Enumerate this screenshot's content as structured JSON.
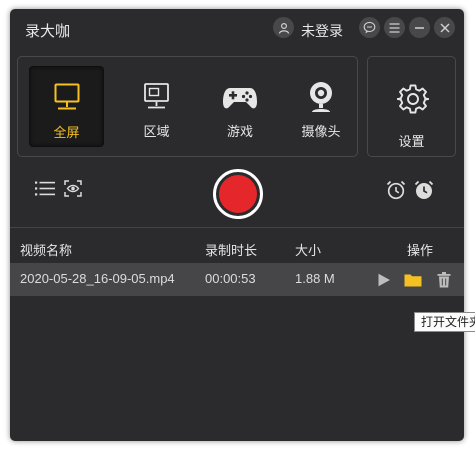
{
  "app": {
    "title": "录大咖"
  },
  "header": {
    "login_status": "未登录",
    "buttons": [
      "chat-icon",
      "menu-icon",
      "minimize-icon",
      "close-icon"
    ]
  },
  "modes": [
    {
      "label": "全屏",
      "icon": "monitor-icon",
      "selected": true
    },
    {
      "label": "区域",
      "icon": "region-icon",
      "selected": false
    },
    {
      "label": "游戏",
      "icon": "gamepad-icon",
      "selected": false
    },
    {
      "label": "摄像头",
      "icon": "webcam-icon",
      "selected": false
    }
  ],
  "settings": {
    "label": "设置",
    "icon": "gear-icon"
  },
  "toolbar": {
    "left_icons": [
      "list-icon",
      "preview-eye-icon"
    ],
    "right_icons": [
      "alarm-clock-icon",
      "timer-clock-icon"
    ]
  },
  "table": {
    "headers": [
      "视频名称",
      "录制时长",
      "大小",
      "操作"
    ],
    "rows": [
      {
        "name": "2020-05-28_16-09-05.mp4",
        "duration": "00:00:53",
        "size": "1.88 M"
      }
    ]
  },
  "tooltip": {
    "text": "打开文件夹"
  },
  "colors": {
    "accent": "#f5c022",
    "record": "#e5272b",
    "background": "#2b2b2d",
    "row_highlight": "#464649"
  }
}
